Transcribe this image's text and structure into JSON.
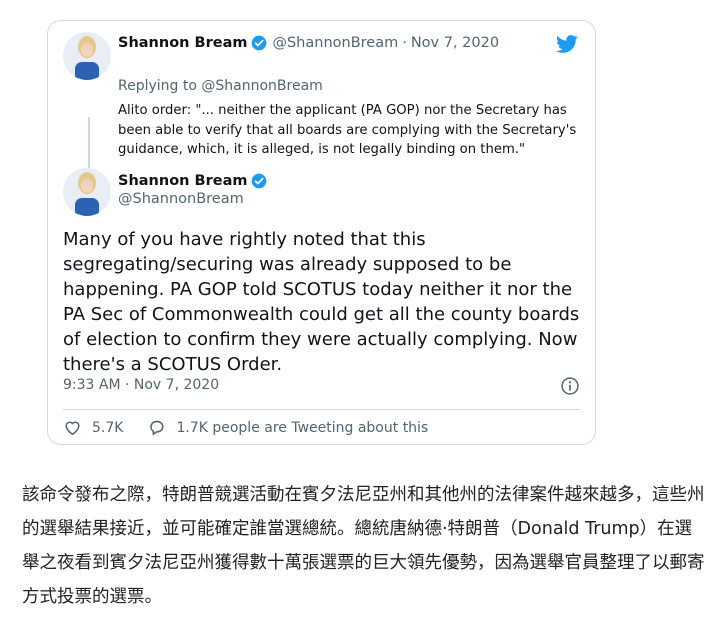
{
  "quoted_tweet": {
    "display_name": "Shannon Bream",
    "handle": "@ShannonBream",
    "separator": "·",
    "date": "Nov 7, 2020",
    "replying_to": "Replying to @ShannonBream",
    "text": "Alito order:  \"... neither the applicant (PA GOP) nor the Secretary has been able to verify that all boards are complying with the Secretary's guidance, which, it is alleged, is not legally binding on them.\""
  },
  "main_tweet": {
    "display_name": "Shannon Bream",
    "handle": "@ShannonBream",
    "text": "Many of you have rightly noted that this segregating/securing was already supposed to be happening.  PA GOP told SCOTUS today neither it nor the PA Sec of Commonwealth could get all the county boards of election to confirm they were actually complying. Now there's a SCOTUS Order.",
    "timestamp": "9:33 AM · Nov 7, 2020",
    "likes": "5.7K",
    "replies_text": "1.7K people are Tweeting about this"
  },
  "article_text": "該命令發布之際，特朗普競選活動在賓夕法尼亞州和其他州的法律案件越來越多，這些州的選舉結果接近，並可能確定誰當選總統。總統唐納德·特朗普（Donald Trump）在選舉之夜看到賓夕法尼亞州獲得數十萬張選票的巨大領先優勢，因為選舉官員整理了以郵寄方式投票的選票。",
  "icons": [
    "twitter-bird-icon",
    "verified-badge-icon",
    "info-icon",
    "heart-icon",
    "reply-bubble-icon"
  ],
  "colors": {
    "twitter_blue": "#1d9bf0",
    "muted": "#536471",
    "border": "#cfd9de"
  }
}
